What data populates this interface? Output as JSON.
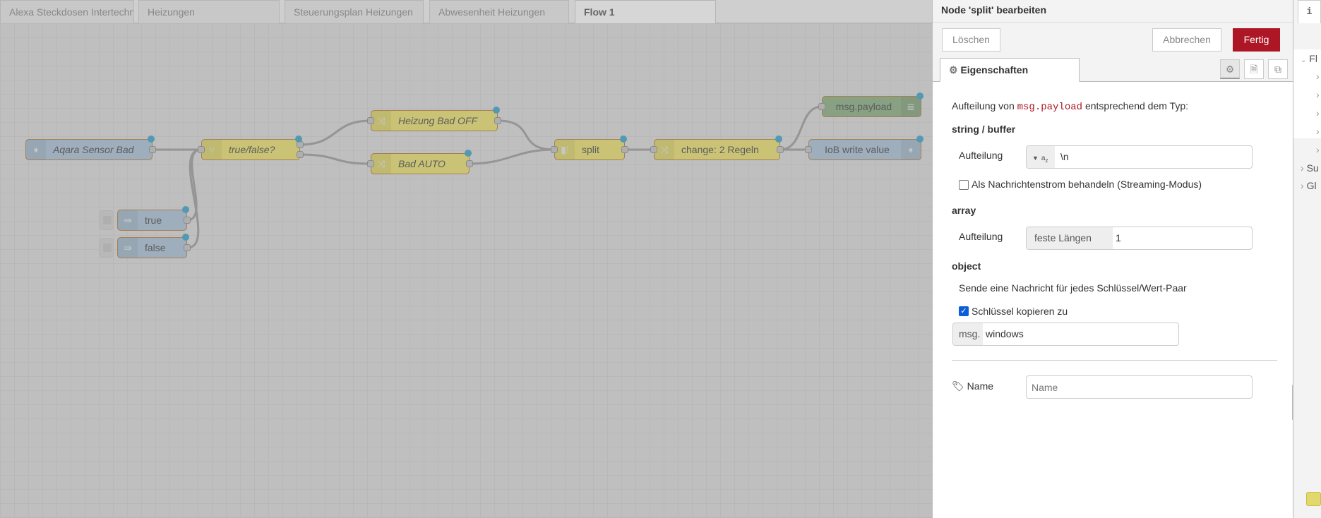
{
  "workspace_tabs": [
    {
      "label": "Alexa Steckdosen Intertechno"
    },
    {
      "label": "Heizungen"
    },
    {
      "label": "Steuerungsplan Heizungen"
    },
    {
      "label": "Abwesenheit Heizungen"
    },
    {
      "label": "Flow 1",
      "active": true
    }
  ],
  "nodes": {
    "aqara": {
      "label": "Aqara Sensor Bad",
      "type": "ioBroker in",
      "color": "#a6bbcf"
    },
    "switch": {
      "label": "true/false?",
      "type": "switch",
      "color": "#e2d96e"
    },
    "heizung_off": {
      "label": "Heizung Bad OFF",
      "type": "change",
      "color": "#e2d96e"
    },
    "bad_auto": {
      "label": "Bad AUTO",
      "type": "change",
      "color": "#e2d96e"
    },
    "split": {
      "label": "split",
      "type": "split",
      "color": "#e2d96e"
    },
    "change2": {
      "label": "change: 2 Regeln",
      "type": "change",
      "color": "#e2d96e"
    },
    "debug": {
      "label": "msg.payload",
      "type": "debug",
      "color": "#87a980"
    },
    "iob_out": {
      "label": "IoB write value",
      "type": "ioBroker out",
      "color": "#a6bbcf"
    },
    "inject_true": {
      "label": "true",
      "type": "inject",
      "color": "#a6bbcf"
    },
    "inject_false": {
      "label": "false",
      "type": "inject",
      "color": "#a6bbcf"
    }
  },
  "editor": {
    "title": "Node 'split' bearbeiten",
    "delete_label": "Löschen",
    "cancel_label": "Abbrechen",
    "done_label": "Fertig",
    "tab_properties": "Eigenschaften",
    "intro_pre": "Aufteilung von",
    "intro_code": "msg.payload",
    "intro_post": "entsprechend dem Typ:",
    "string_heading": "string / buffer",
    "string_split_label": "Aufteilung",
    "string_split_type": "az",
    "string_split_value": "\\n",
    "stream_label": "Als Nachrichtenstrom behandeln (Streaming-Modus)",
    "stream_checked": false,
    "array_heading": "array",
    "array_split_label": "Aufteilung",
    "array_split_prefix": "feste Längen von",
    "array_split_value": "1",
    "object_heading": "object",
    "object_desc": "Sende eine Nachricht für jedes Schlüssel/Wert-Paar",
    "copy_key_label": "Schlüssel kopieren zu",
    "copy_key_checked": true,
    "copy_key_prefix": "msg.",
    "copy_key_value": "windows",
    "name_label": "Name",
    "name_placeholder": "Name",
    "accent_color": "#ad1625"
  },
  "sidebar": {
    "tab_icon": "info-icon",
    "tab_label": "i",
    "tree": [
      {
        "label": "Fl",
        "expanded": true
      },
      {
        "label": "›"
      },
      {
        "label": "›"
      },
      {
        "label": "›"
      },
      {
        "label": "›"
      },
      {
        "label": "›"
      },
      {
        "label": "Su"
      },
      {
        "label": "Gl"
      }
    ]
  }
}
